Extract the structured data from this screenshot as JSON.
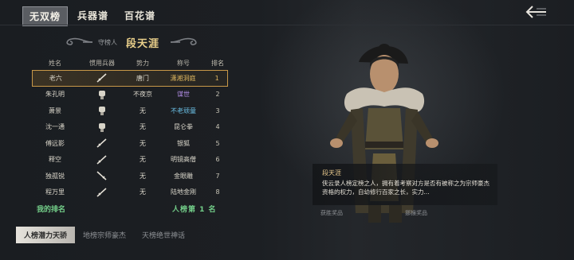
{
  "top_tabs": [
    "无双榜",
    "兵器谱",
    "百花谱"
  ],
  "guardian": {
    "label": "守榜人",
    "name": "段天涯"
  },
  "table": {
    "headers": [
      "姓名",
      "惯用兵器",
      "势力",
      "称号",
      "排名"
    ],
    "rows": [
      {
        "name": "老六",
        "weapon": "sword-icon",
        "force": "唐门",
        "title": "潇湘洞庭",
        "rank": "1"
      },
      {
        "name": "朱孔明",
        "weapon": "fist-icon",
        "force": "不夜京",
        "title": "谋世",
        "rank": "2"
      },
      {
        "name": "萧景",
        "weapon": "fist-icon",
        "force": "无",
        "title": "不老顽童",
        "rank": "3"
      },
      {
        "name": "沈一通",
        "weapon": "fist-icon",
        "force": "无",
        "title": "昆仑拳",
        "rank": "4"
      },
      {
        "name": "傅远影",
        "weapon": "sword-icon",
        "force": "无",
        "title": "银狐",
        "rank": "5"
      },
      {
        "name": "释空",
        "weapon": "sword-icon",
        "force": "无",
        "title": "明镜高僧",
        "rank": "6"
      },
      {
        "name": "独孤锐",
        "weapon": "sword-icon",
        "force": "无",
        "title": "金眼雕",
        "rank": "7"
      },
      {
        "name": "程万里",
        "weapon": "sword-icon",
        "force": "无",
        "title": "陆地金刚",
        "rank": "8"
      }
    ]
  },
  "my_rank": {
    "label": "我的排名",
    "value": "人榜第 1 名"
  },
  "bottom_tabs": [
    "人榜潜力天骄",
    "地榜宗师豪杰",
    "天榜绝世神话"
  ],
  "info": {
    "name": "段天涯",
    "description": "侠云录人榜定榜之人，拥有着考察对方是否有被称之为宗师豪杰资格的权力，自幼修行百家之长，实力..."
  },
  "rewards": {
    "left": "获胜奖品",
    "right": "挪猴奖品"
  },
  "colors": {
    "accent_gold": "#e0b860",
    "selected_border": "#c89848",
    "my_rank_green": "#74d08a"
  }
}
